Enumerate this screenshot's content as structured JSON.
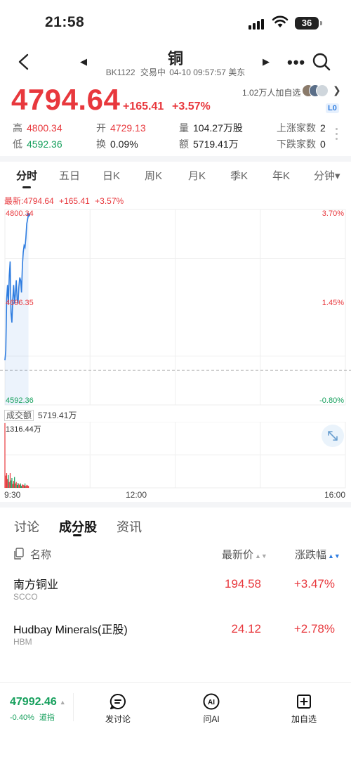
{
  "status_bar": {
    "time": "21:58",
    "battery": "36"
  },
  "header": {
    "title": "铜",
    "code": "BK1122",
    "trading_status": "交易中",
    "timestamp": "04-10 09:57:57 美东",
    "followers": "1.02万人加自选",
    "level_badge": "L0"
  },
  "quote": {
    "price": "4794.64",
    "change": "+165.41",
    "change_pct": "+3.57%",
    "high_label": "高",
    "high": "4800.34",
    "low_label": "低",
    "low": "4592.36",
    "open_label": "开",
    "open": "4729.13",
    "turnover_label": "换",
    "turnover": "0.09%",
    "volume_label": "量",
    "volume": "104.27万股",
    "amount_label": "额",
    "amount": "5719.41万",
    "rising_label": "上涨家数",
    "rising": "2",
    "falling_label": "下跌家数",
    "falling": "0"
  },
  "chart_tabs": [
    "分时",
    "五日",
    "日K",
    "周K",
    "月K",
    "季K",
    "年K",
    "分钟▾"
  ],
  "chart": {
    "latest_prefix": "最新:",
    "latest_price": "4794.64",
    "latest_change": "+165.41",
    "latest_pct": "+3.57%",
    "y_top": "4800.34",
    "y_mid": "4696.35",
    "y_bottom": "4592.36",
    "pct_top": "3.70%",
    "pct_mid": "1.45%",
    "pct_bottom": "-0.80%",
    "volume_label": "成交额",
    "volume_value": "5719.41万",
    "volume_max": "1316.44万",
    "time_start": "9:30",
    "time_mid": "12:00",
    "time_end": "16:00"
  },
  "chart_data": {
    "type": "line",
    "x": [
      "9:30",
      "9:31",
      "9:32",
      "9:33",
      "9:34",
      "9:35",
      "9:36",
      "9:37",
      "9:38",
      "9:39",
      "9:40",
      "9:41",
      "9:42",
      "9:43",
      "9:44",
      "9:45",
      "9:46",
      "9:47",
      "9:48",
      "9:49",
      "9:50",
      "9:51",
      "9:52",
      "9:53",
      "9:54",
      "9:55",
      "9:56",
      "9:57"
    ],
    "values": [
      4640,
      4650,
      4705,
      4720,
      4700,
      4730,
      4745,
      4690,
      4680,
      4705,
      4720,
      4700,
      4710,
      4725,
      4705,
      4700,
      4718,
      4728,
      4725,
      4712,
      4740,
      4755,
      4762,
      4760,
      4770,
      4785,
      4790,
      4794.64
    ],
    "volume": [
      1316,
      250,
      300,
      180,
      260,
      120,
      300,
      150,
      200,
      80,
      140,
      220,
      90,
      120,
      60,
      100,
      80,
      60,
      90,
      40,
      70,
      60,
      50,
      90,
      40,
      60,
      50,
      40
    ],
    "ylim": [
      4592.36,
      4800.34
    ],
    "xlim": [
      "9:30",
      "16:00"
    ],
    "prev_close": 4629.23,
    "line_color": "#2f7de0",
    "up_color": "#e8383d",
    "down_color": "#17a05d"
  },
  "sub_tabs": [
    "讨论",
    "成分股",
    "资讯"
  ],
  "table": {
    "col_name": "名称",
    "col_price": "最新价",
    "col_change": "涨跌幅",
    "rows": [
      {
        "name": "南方铜业",
        "code": "SCCO",
        "price": "194.58",
        "change": "+3.47%"
      },
      {
        "name": "Hudbay Minerals(正股)",
        "code": "HBM",
        "price": "24.12",
        "change": "+2.78%"
      }
    ]
  },
  "bottom_bar": {
    "index_value": "47992.46",
    "index_change": "-0.40%",
    "index_name": "道指",
    "discuss_label": "发讨论",
    "ai_label": "问AI",
    "watch_label": "加自选"
  },
  "colors": {
    "up": "#e8383d",
    "down": "#17a05d",
    "accent": "#2f7de0"
  }
}
